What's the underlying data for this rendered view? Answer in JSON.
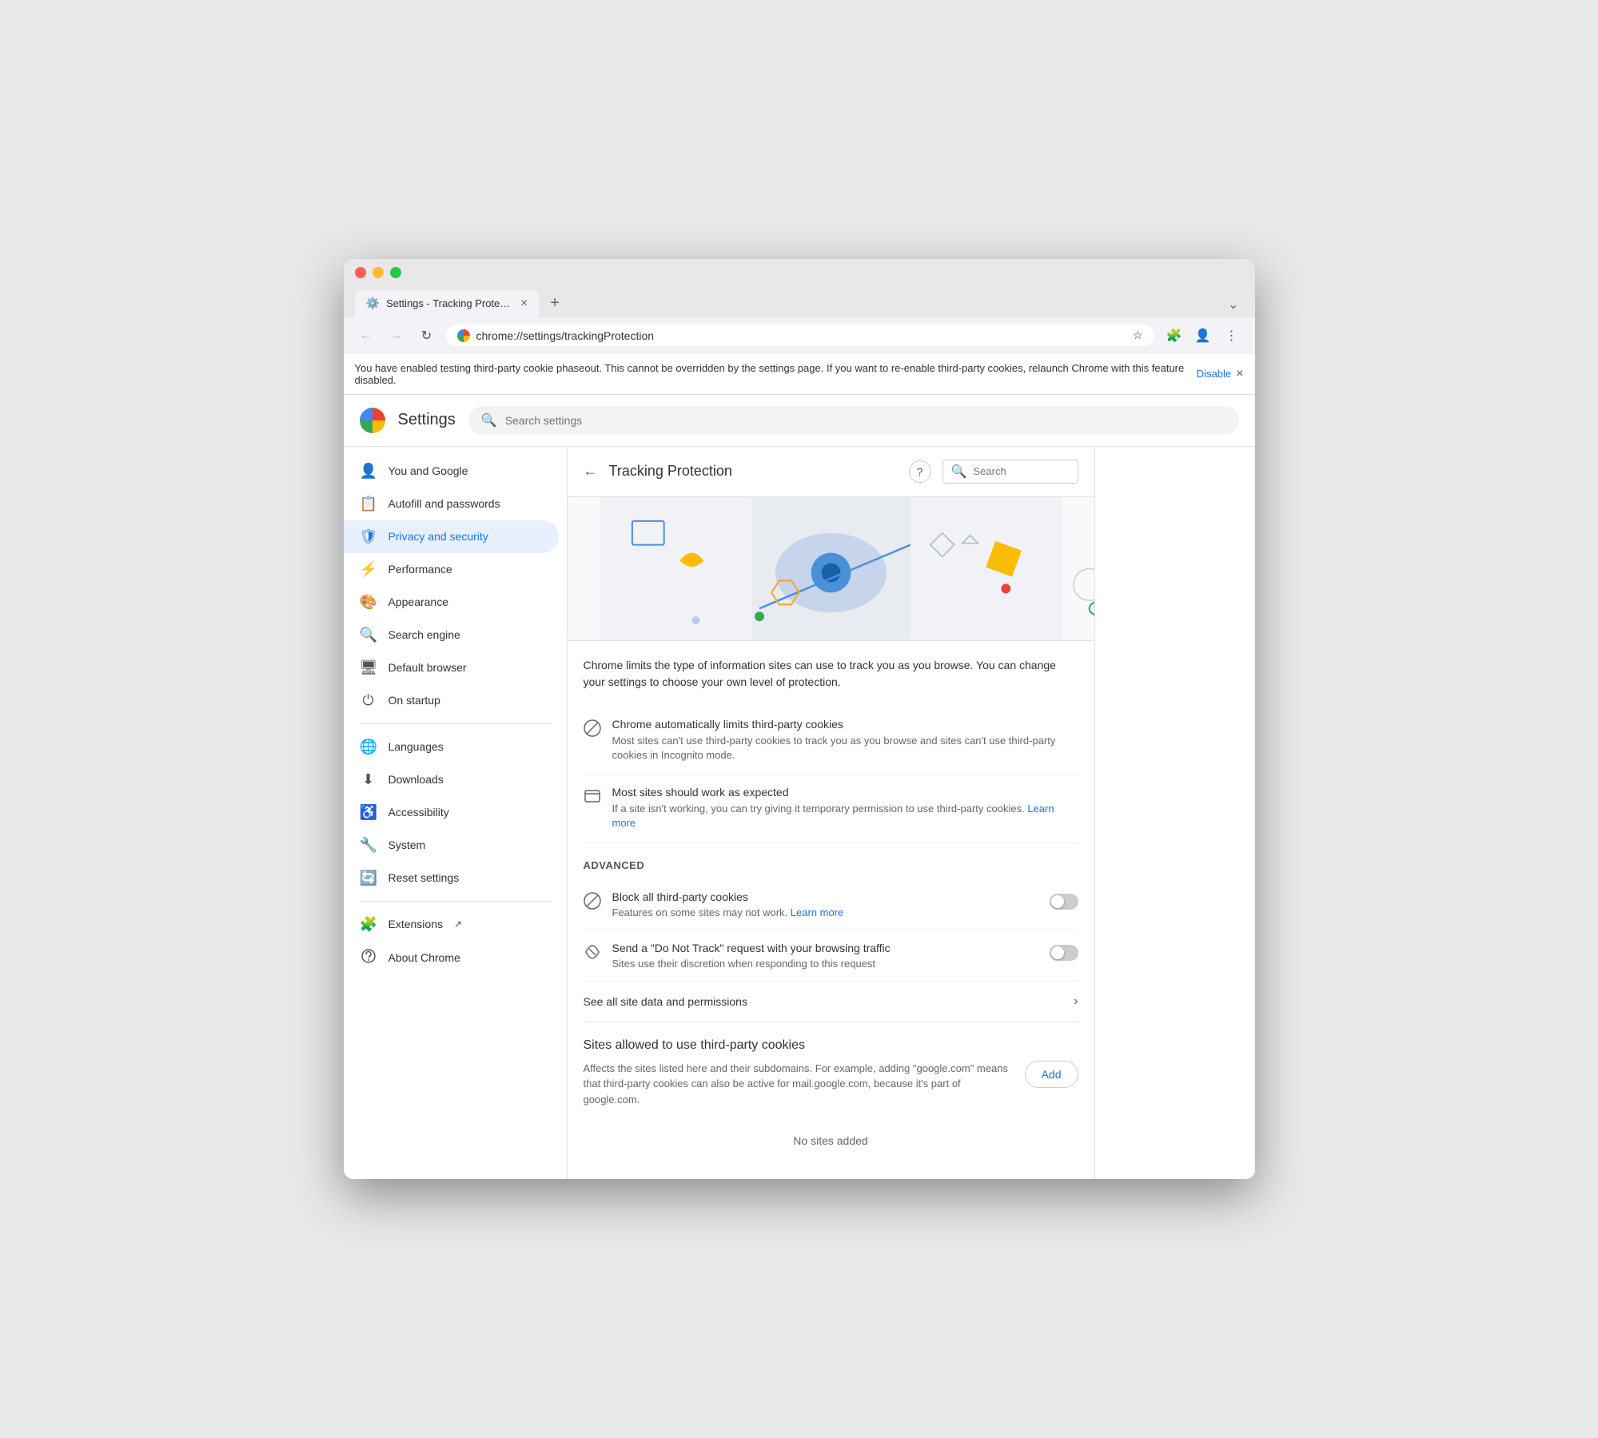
{
  "browser": {
    "tab_title": "Settings - Tracking Protectio...",
    "tab_close": "×",
    "new_tab": "+",
    "back_btn": "←",
    "forward_btn": "→",
    "refresh_btn": "↻",
    "address": "chrome://settings/trackingProtection",
    "menu_btn": "⋮",
    "chevron_down": "⌄"
  },
  "banner": {
    "text": "You have enabled testing third-party cookie phaseout. This cannot be overridden by the settings page. If you want to re-enable third-party cookies, relaunch Chrome with this feature disabled.",
    "link_text": "Disable",
    "close": "×"
  },
  "settings": {
    "title": "Settings",
    "search_placeholder": "Search settings"
  },
  "sidebar": {
    "items": [
      {
        "id": "you-and-google",
        "label": "You and Google",
        "icon": "👤"
      },
      {
        "id": "autofill",
        "label": "Autofill and passwords",
        "icon": "📋"
      },
      {
        "id": "privacy",
        "label": "Privacy and security",
        "icon": "🛡",
        "active": true
      },
      {
        "id": "performance",
        "label": "Performance",
        "icon": "⚡"
      },
      {
        "id": "appearance",
        "label": "Appearance",
        "icon": "🎨"
      },
      {
        "id": "search-engine",
        "label": "Search engine",
        "icon": "🔍"
      },
      {
        "id": "default-browser",
        "label": "Default browser",
        "icon": "🖥"
      },
      {
        "id": "on-startup",
        "label": "On startup",
        "icon": "⏻"
      }
    ],
    "items2": [
      {
        "id": "languages",
        "label": "Languages",
        "icon": "🌐"
      },
      {
        "id": "downloads",
        "label": "Downloads",
        "icon": "⬇"
      },
      {
        "id": "accessibility",
        "label": "Accessibility",
        "icon": "♿"
      },
      {
        "id": "system",
        "label": "System",
        "icon": "🔧"
      },
      {
        "id": "reset-settings",
        "label": "Reset settings",
        "icon": "🔄"
      }
    ],
    "items3": [
      {
        "id": "extensions",
        "label": "Extensions",
        "icon": "🧩",
        "external": true
      },
      {
        "id": "about",
        "label": "About Chrome",
        "icon": "🌀"
      }
    ]
  },
  "tracking": {
    "back_btn": "←",
    "title": "Tracking Protection",
    "help": "?",
    "search_placeholder": "Search",
    "description": "Chrome limits the type of information sites can use to track you as you browse. You can change your settings to choose your own level of protection.",
    "option1_title": "Chrome automatically limits third-party cookies",
    "option1_desc": "Most sites can't use third-party cookies to track you as you browse and sites can't use third-party cookies in Incognito mode.",
    "option2_title": "Most sites should work as expected",
    "option2_desc": "If a site isn't working, you can try giving it temporary permission to use third-party cookies.",
    "option2_link": "Learn more",
    "advanced_header": "Advanced",
    "block_title": "Block all third-party cookies",
    "block_desc": "Features on some sites may not work.",
    "block_link": "Learn more",
    "dnt_title": "Send a \"Do Not Track\" request with your browsing traffic",
    "dnt_desc": "Sites use their discretion when responding to this request",
    "see_all": "See all site data and permissions",
    "sites_title": "Sites allowed to use third-party cookies",
    "sites_desc": "Affects the sites listed here and their subdomains. For example, adding \"google.com\" means that third-party cookies can also be active for mail.google.com, because it's part of google.com.",
    "add_btn": "Add",
    "no_sites": "No sites added",
    "block_toggle": false,
    "dnt_toggle": false
  }
}
